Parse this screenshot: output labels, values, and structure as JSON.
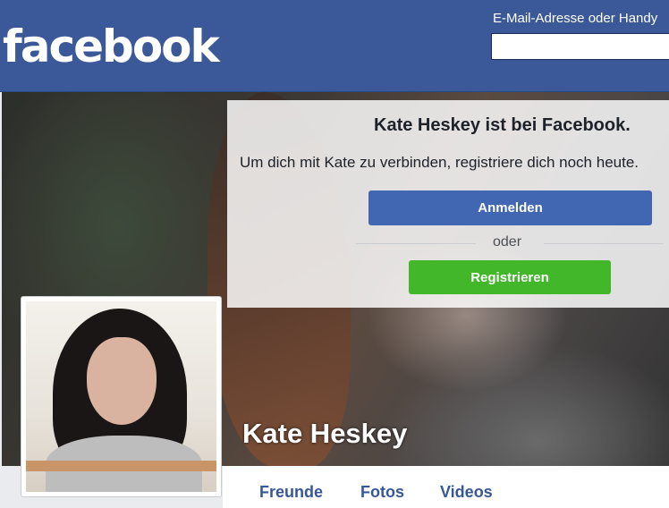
{
  "header": {
    "logo_text": "facebook",
    "login_label": "E-Mail-Adresse oder Handy",
    "login_value": ""
  },
  "overlay": {
    "title": "Kate Heskey ist bei Facebook.",
    "subtitle": "Um dich mit Kate zu verbinden, registriere dich noch heute.",
    "login_button": "Anmelden",
    "divider_text": "oder",
    "register_button": "Registrieren"
  },
  "profile": {
    "name": "Kate Heskey"
  },
  "tabs": [
    {
      "label": "Freunde"
    },
    {
      "label": "Fotos"
    },
    {
      "label": "Videos"
    }
  ],
  "colors": {
    "brand": "#3b5998",
    "login_button": "#4267b2",
    "register_button": "#42b72a",
    "tab_text": "#365899"
  }
}
